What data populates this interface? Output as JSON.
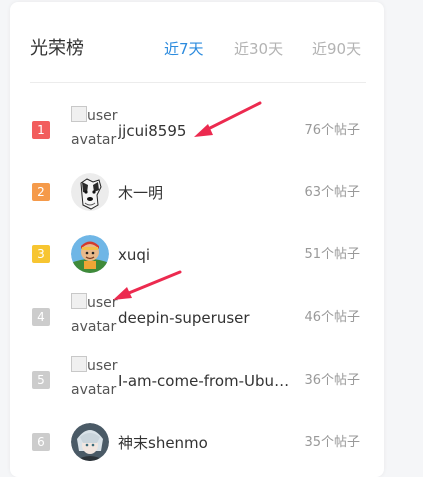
{
  "panel": {
    "title": "光荣榜",
    "tabs": [
      {
        "label": "近7天",
        "active": true
      },
      {
        "label": "近30天",
        "active": false
      },
      {
        "label": "近90天",
        "active": false
      }
    ]
  },
  "rank_colors": {
    "1": "#f25d5d",
    "2": "#f59a4a",
    "3": "#f7c531",
    "other": "#cccccc"
  },
  "broken_avatar_alt": "user avatar",
  "entries": [
    {
      "rank": "1",
      "username": "jjcui8595",
      "count": "76个帖子",
      "avatar": "broken"
    },
    {
      "rank": "2",
      "username": "木一明",
      "count": "63个帖子",
      "avatar": "photo"
    },
    {
      "rank": "3",
      "username": "xuqi",
      "count": "51个帖子",
      "avatar": "photo"
    },
    {
      "rank": "4",
      "username": "deepin-superuser",
      "count": "46个帖子",
      "avatar": "broken"
    },
    {
      "rank": "5",
      "username": "I-am-come-from-Ubuntu",
      "count": "36个帖子",
      "avatar": "broken"
    },
    {
      "rank": "6",
      "username": "神末shenmo",
      "count": "35个帖子",
      "avatar": "photo"
    }
  ]
}
